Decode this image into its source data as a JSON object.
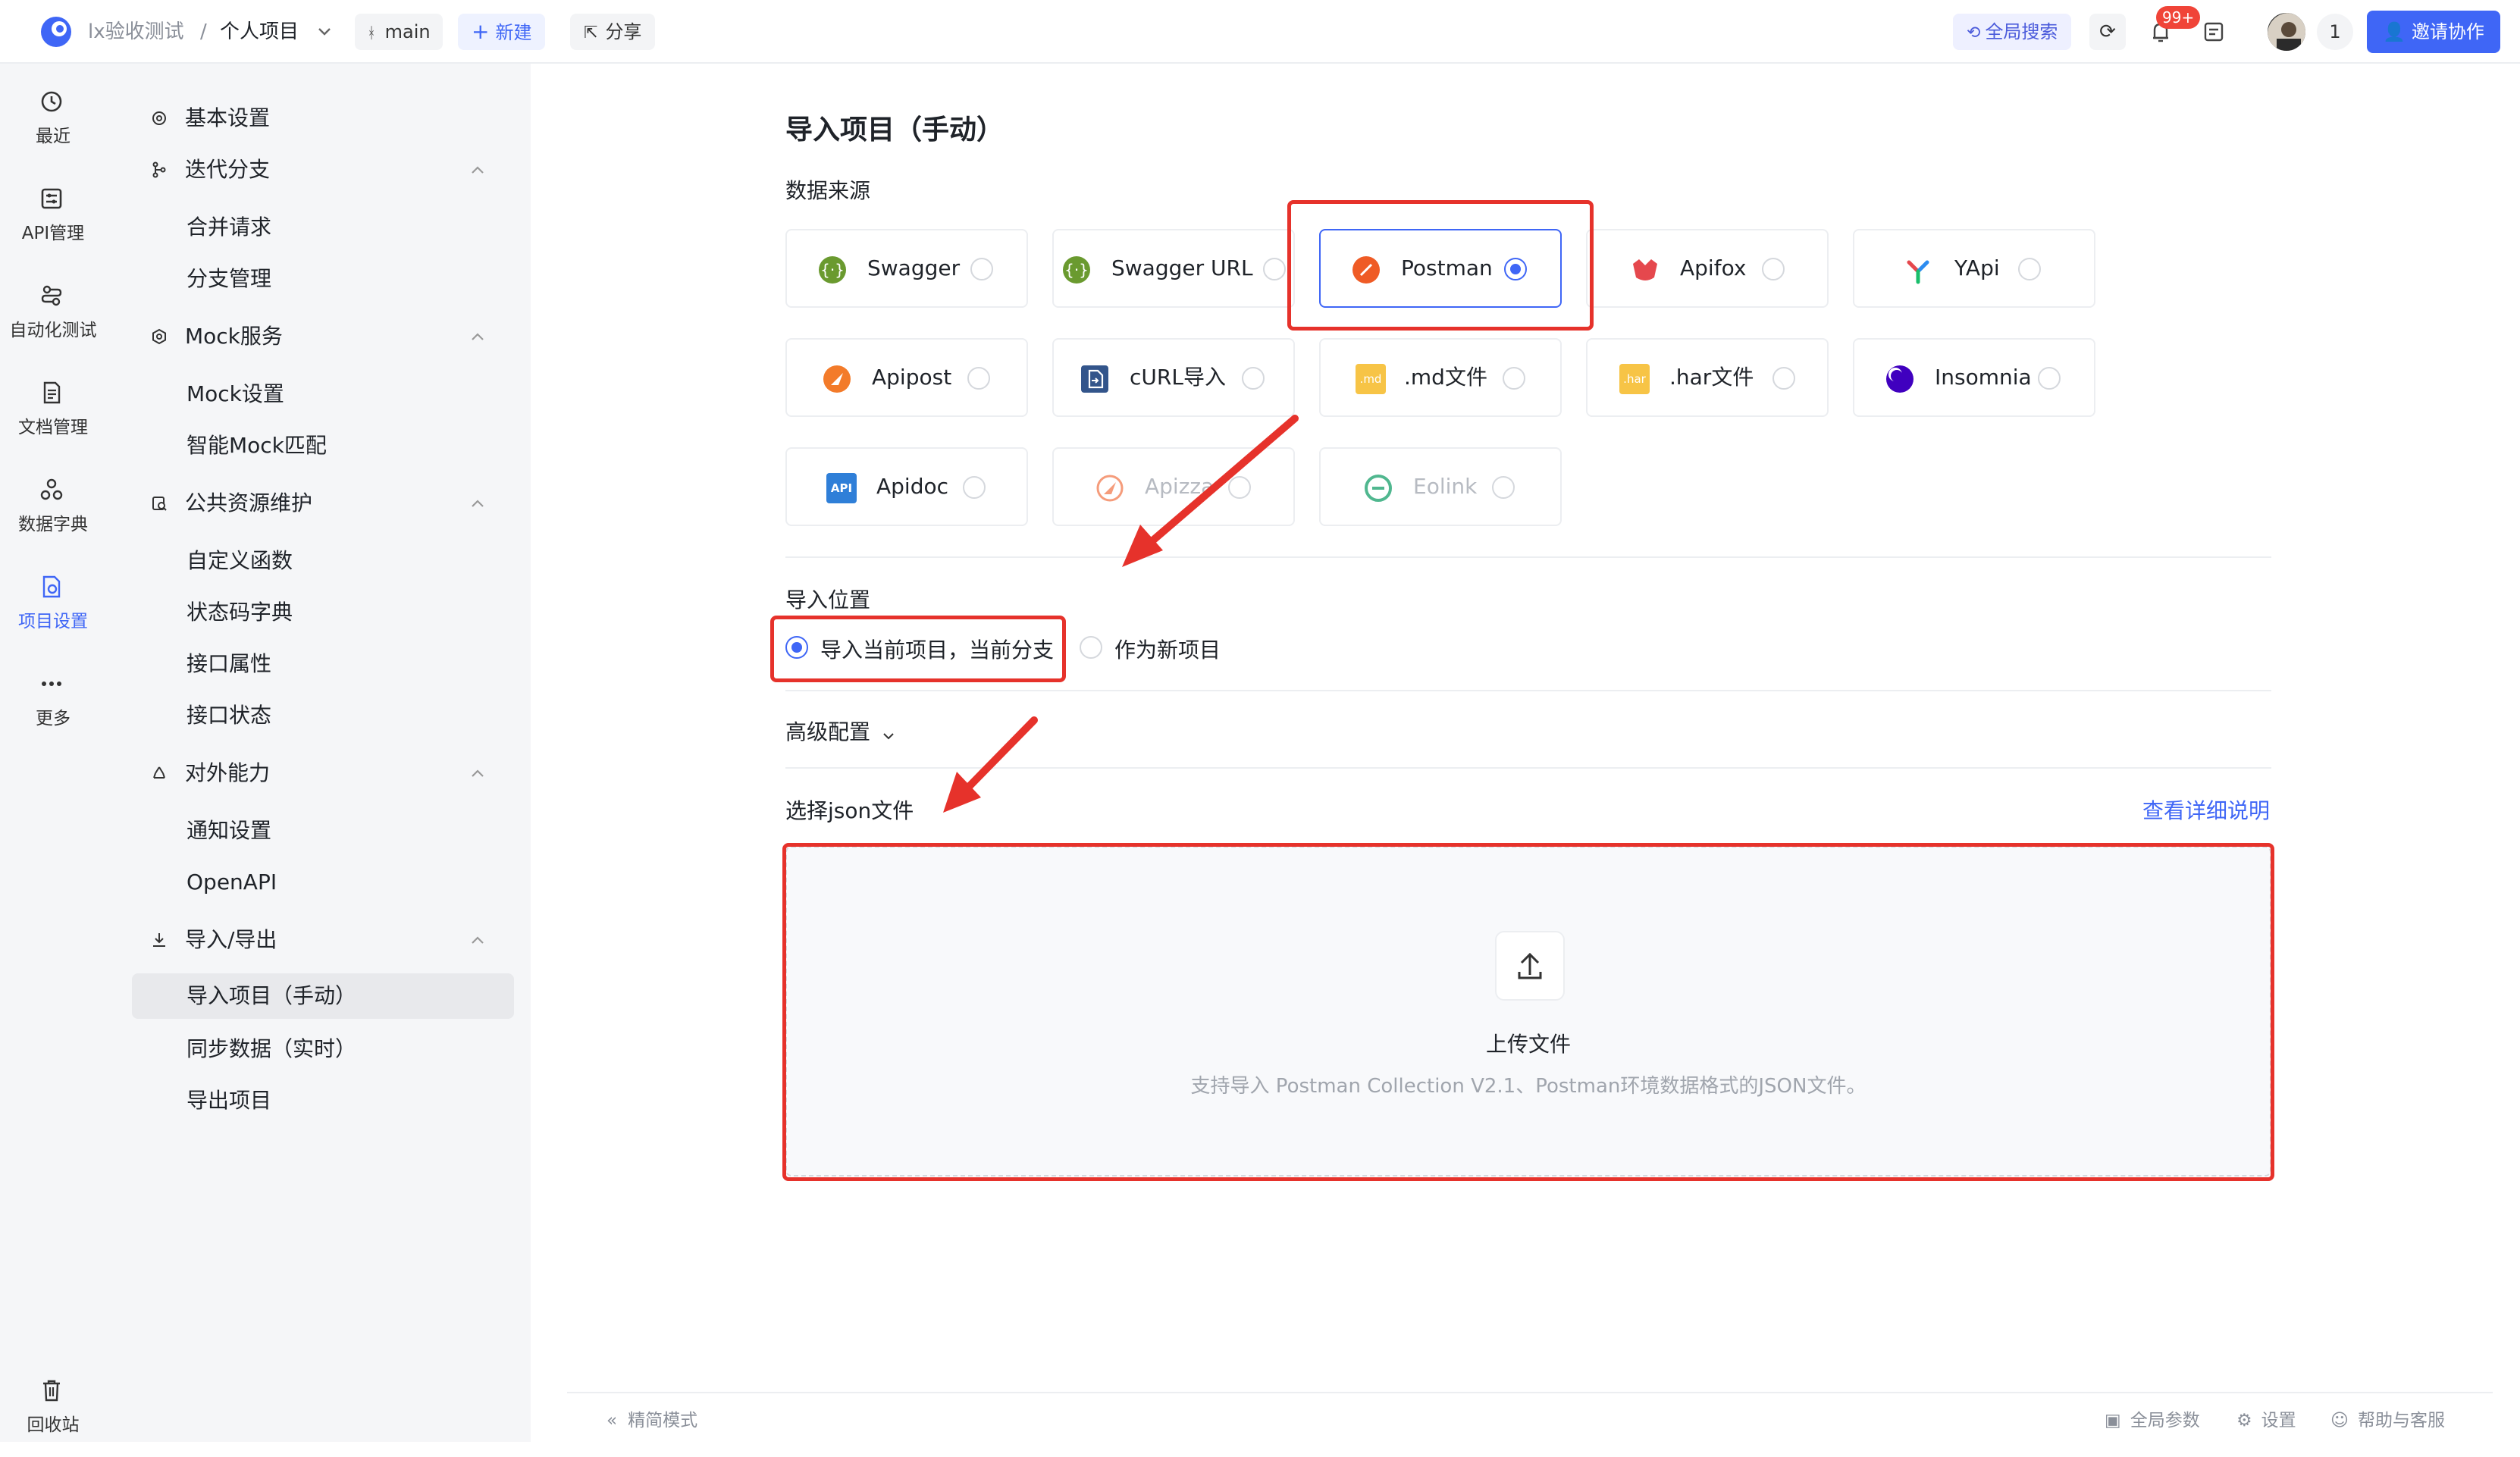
{
  "topbar": {
    "project_group": "lx验收测试",
    "separator": "/",
    "project_name": "个人项目",
    "branch": "main",
    "new_label": "新建",
    "share_label": "分享",
    "global_search": "全局搜索",
    "notification_badge": "99+",
    "collaborator_count": "1",
    "invite_label": "邀请协作"
  },
  "rail": {
    "items": [
      {
        "label": "最近",
        "icon": "history-icon"
      },
      {
        "label": "API管理",
        "icon": "api-icon"
      },
      {
        "label": "自动化测试",
        "icon": "automation-icon"
      },
      {
        "label": "文档管理",
        "icon": "document-icon"
      },
      {
        "label": "数据字典",
        "icon": "dictionary-icon"
      },
      {
        "label": "项目设置",
        "icon": "project-settings-icon"
      },
      {
        "label": "更多",
        "icon": "more-icon"
      }
    ],
    "trash_label": "回收站"
  },
  "nav": {
    "basic_settings": "基本设置",
    "iteration_branch": "迭代分支",
    "merge_request": "合并请求",
    "branch_management": "分支管理",
    "mock_service": "Mock服务",
    "mock_settings": "Mock设置",
    "smart_mock": "智能Mock匹配",
    "public_resources": "公共资源维护",
    "custom_functions": "自定义函数",
    "status_codes": "状态码字典",
    "api_attributes": "接口属性",
    "api_status": "接口状态",
    "external": "对外能力",
    "notification_settings": "通知设置",
    "openapi": "OpenAPI",
    "import_export": "导入/导出",
    "import_manual": "导入项目（手动）",
    "sync_realtime": "同步数据（实时）",
    "export_project": "导出项目"
  },
  "main": {
    "title": "导入项目（手动）",
    "data_source_label": "数据来源",
    "sources": [
      {
        "name": "Swagger",
        "icon": "swagger-icon"
      },
      {
        "name": "Swagger URL",
        "icon": "swagger-url-icon"
      },
      {
        "name": "Postman",
        "icon": "postman-icon",
        "selected": true
      },
      {
        "name": "Apifox",
        "icon": "apifox-icon"
      },
      {
        "name": "YApi",
        "icon": "yapi-icon"
      },
      {
        "name": "Apipost",
        "icon": "apipost-icon"
      },
      {
        "name": "cURL导入",
        "icon": "curl-icon"
      },
      {
        "name": ".md文件",
        "icon": "md-file-icon",
        "badge": ".md"
      },
      {
        "name": ".har文件",
        "icon": "har-file-icon",
        "badge": ".har"
      },
      {
        "name": "Insomnia",
        "icon": "insomnia-icon"
      },
      {
        "name": "Apidoc",
        "icon": "apidoc-icon",
        "badge": "API"
      },
      {
        "name": "Apizza",
        "icon": "apizza-icon",
        "disabled": true
      },
      {
        "name": "Eolink",
        "icon": "eolink-icon",
        "disabled": true
      }
    ],
    "import_location_label": "导入位置",
    "location_current": "导入当前项目，当前分支",
    "location_new": "作为新项目",
    "advanced_config": "高级配置",
    "select_json_label": "选择json文件",
    "details_link": "查看详细说明",
    "upload_title": "上传文件",
    "upload_hint": "支持导入 Postman Collection V2.1、Postman环境数据格式的JSON文件。"
  },
  "bottombar": {
    "compact_mode": "精简模式",
    "global_params": "全局参数",
    "settings": "设置",
    "help": "帮助与客服"
  },
  "colors": {
    "accent": "#3f66f6",
    "annotation_red": "#e6322b",
    "sidebar_bg": "#f5f6f8",
    "badge_red": "#f04438"
  }
}
